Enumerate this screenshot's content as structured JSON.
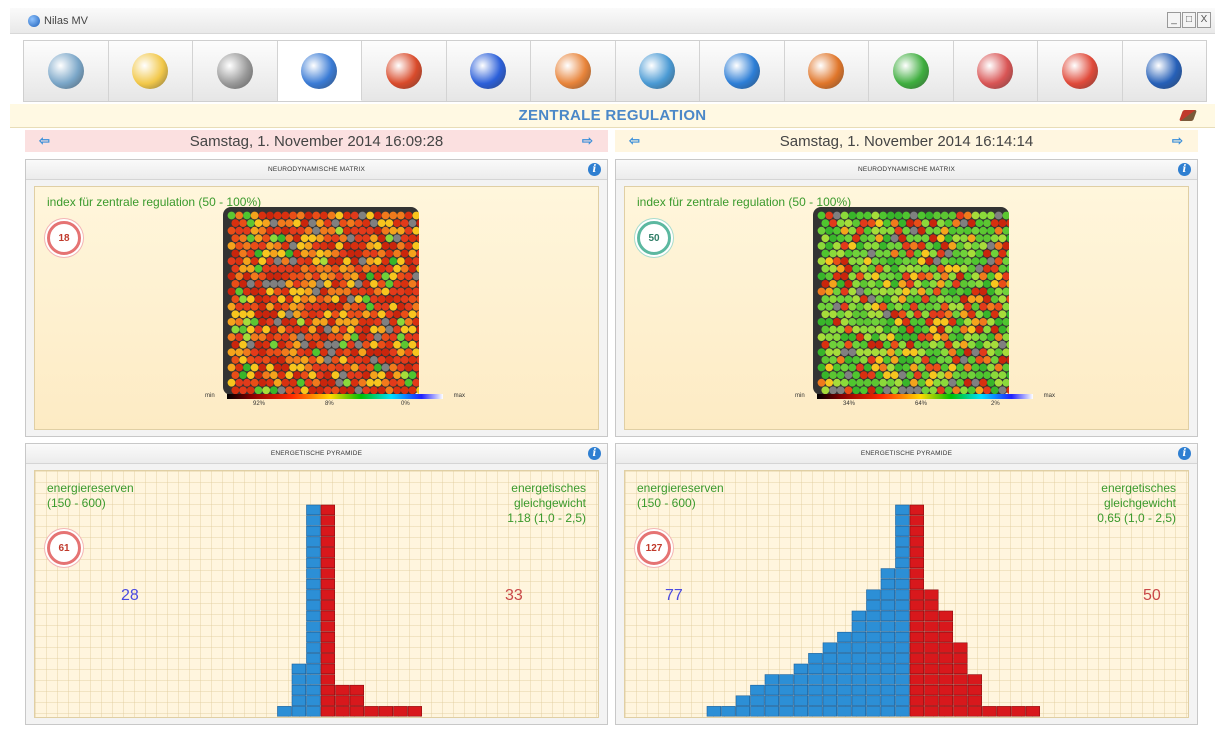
{
  "window": {
    "title": "Nilas MV",
    "buttons": [
      "_",
      "□",
      "X"
    ]
  },
  "toolbar": {
    "items": [
      {
        "icon": "waveform-monitor-icon",
        "color": "#7aa6c8"
      },
      {
        "icon": "heat-sphere-icon",
        "color": "#f2c84a"
      },
      {
        "icon": "scatter-dots-icon",
        "color": "#999999"
      },
      {
        "icon": "hexagon-cluster-icon",
        "color": "#3a7bd5",
        "active": true
      },
      {
        "icon": "heatmap-map-icon",
        "color": "#d94b2b"
      },
      {
        "icon": "spectrum-field-icon",
        "color": "#2b5fd9"
      },
      {
        "icon": "pie-sphere-icon",
        "color": "#e8843a"
      },
      {
        "icon": "line-graph-icon",
        "color": "#4a9ad4"
      },
      {
        "icon": "head-profile-icon",
        "color": "#2d7ed6"
      },
      {
        "icon": "om-symbol-icon",
        "color": "#e0762a"
      },
      {
        "icon": "yin-yang-icon",
        "color": "#3fae3f"
      },
      {
        "icon": "pentagon-cube-icon",
        "color": "#d95555"
      },
      {
        "icon": "bar-chart-icon",
        "color": "#e04a3a"
      },
      {
        "icon": "globe-icon",
        "color": "#2660b8"
      }
    ]
  },
  "section": {
    "title": "ZENTRALE REGULATION"
  },
  "left": {
    "date": "Samstag, 1. November 2014 16:09:28",
    "matrix": {
      "header": "NEURODYNAMISCHE MATRIX",
      "index_label": "index für zentrale regulation (50 - 100%)",
      "score": "18",
      "scale_min": "min",
      "scale_max": "max",
      "pct": [
        "92%",
        "8%",
        "0%"
      ],
      "dominant": "red"
    },
    "pyramid": {
      "header": "ENERGETISCHE PYRAMIDE",
      "reserve_label": "energiereserven",
      "reserve_range": "(150 - 600)",
      "balance_label1": "energetisches",
      "balance_label2": "gleichgewicht",
      "balance_value": "1,18 (1,0 - 2,5)",
      "score": "61",
      "left_value": "28",
      "right_value": "33",
      "blue_columns": [
        1,
        5,
        20
      ],
      "red_columns": [
        20,
        3,
        3,
        1,
        1,
        1,
        1
      ]
    }
  },
  "right": {
    "date": "Samstag, 1. November 2014 16:14:14",
    "matrix": {
      "header": "NEURODYNAMISCHE MATRIX",
      "index_label": "index für zentrale regulation (50 - 100%)",
      "score": "50",
      "scale_min": "min",
      "scale_max": "max",
      "pct": [
        "34%",
        "64%",
        "2%"
      ],
      "dominant": "green"
    },
    "pyramid": {
      "header": "ENERGETISCHE PYRAMIDE",
      "reserve_label": "energiereserven",
      "reserve_range": "(150 - 600)",
      "balance_label1": "energetisches",
      "balance_label2": "gleichgewicht",
      "balance_value": "0,65 (1,0 - 2,5)",
      "score": "127",
      "left_value": "77",
      "right_value": "50",
      "blue_columns": [
        1,
        1,
        2,
        3,
        4,
        4,
        5,
        6,
        7,
        8,
        10,
        12,
        14,
        20
      ],
      "red_columns": [
        20,
        12,
        10,
        7,
        4,
        1,
        1,
        1,
        1
      ]
    }
  }
}
